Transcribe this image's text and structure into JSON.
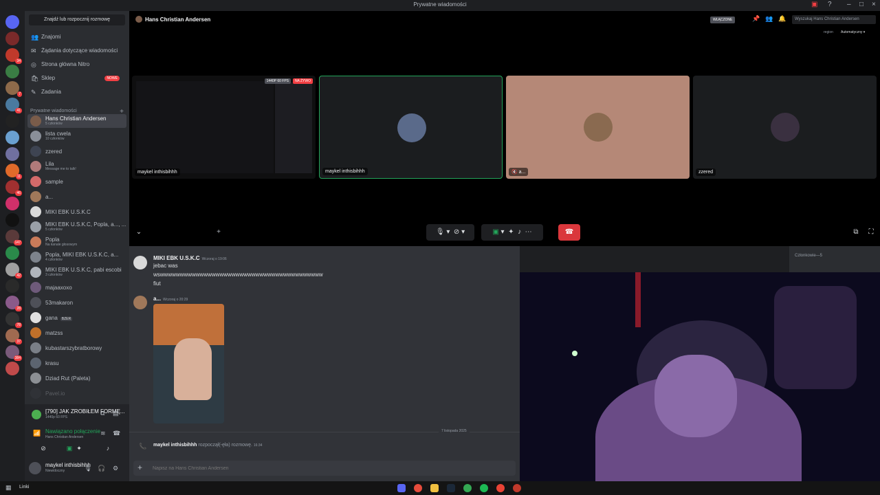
{
  "window": {
    "title": "Prywatne wiadomości"
  },
  "sidebar": {
    "find_button": "Znajdź lub rozpocznij rozmowę",
    "nav": [
      {
        "label": "Znajomi",
        "icon": "friends-icon"
      },
      {
        "label": "Żądania dotyczące wiadomości",
        "icon": "envelope-icon"
      },
      {
        "label": "Strona główna Nitro",
        "icon": "nitro-icon"
      },
      {
        "label": "Sklep",
        "icon": "shop-icon",
        "badge": "NOWE"
      },
      {
        "label": "Zadania",
        "icon": "quests-icon"
      }
    ],
    "section_title": "Prywatne wiadomości",
    "dms": [
      {
        "name": "Hans Christian Andersen",
        "sub": "5 członków",
        "color": "#7a5c4a",
        "active": true
      },
      {
        "name": "lista cwela",
        "sub": "10 członków",
        "color": "#8a8f99"
      },
      {
        "name": "zzered",
        "sub": "",
        "color": "#3e4452"
      },
      {
        "name": "Lila",
        "sub": "Message me to talk!",
        "color": "#b07a7a"
      },
      {
        "name": "sample",
        "sub": "",
        "color": "#d46a6a"
      },
      {
        "name": "a...",
        "sub": "",
        "color": "#a0785a"
      },
      {
        "name": "MIKI EBK U.S.K.C",
        "sub": "",
        "color": "#d9d9d9"
      },
      {
        "name": "MIKI EBK U.S.K.C, Popla, a..., ...",
        "sub": "5 członków",
        "color": "#9aa0a8"
      },
      {
        "name": "Popla",
        "sub": "Na kanale głosowym",
        "color": "#c97b5a"
      },
      {
        "name": "Popla, MIKI EBK U.S.K.C, a...",
        "sub": "4 członków",
        "color": "#7d838c"
      },
      {
        "name": "MIKI EBK U.S.K.C, pabi escobi",
        "sub": "3 członków",
        "color": "#b0b5bc"
      },
      {
        "name": "majaaxoxo",
        "sub": "",
        "color": "#6e5a7a"
      },
      {
        "name": "53makaron",
        "sub": "",
        "color": "#4e5058"
      },
      {
        "name": "gana",
        "sub": "",
        "tag": "BZER",
        "color": "#e0e0e0"
      },
      {
        "name": "matzss",
        "sub": "",
        "color": "#c0702a"
      },
      {
        "name": "kubastarszybratborowy",
        "sub": "",
        "color": "#7a7f87"
      },
      {
        "name": "krasu",
        "sub": "",
        "color": "#5c6470"
      },
      {
        "name": "Dziad Rut (Paleta)",
        "sub": "",
        "color": "#8c8f94"
      },
      {
        "name": "Pavel.io",
        "sub": "",
        "color": "#3a3d44"
      }
    ],
    "servers": [
      {
        "color": "#5865f2",
        "badge": ""
      },
      {
        "color": "#7a2a2a",
        "badge": ""
      },
      {
        "color": "#c0392b",
        "badge": "34"
      },
      {
        "color": "#3a7d44",
        "badge": ""
      },
      {
        "color": "#8e6a4a",
        "badge": "7"
      },
      {
        "color": "#4a7aa0",
        "badge": "41"
      },
      {
        "color": "#222",
        "badge": ""
      },
      {
        "color": "#6aa0d0",
        "badge": ""
      },
      {
        "color": "#7070a0",
        "badge": ""
      },
      {
        "color": "#e06a2a",
        "badge": "11"
      },
      {
        "color": "#a03030",
        "badge": "46"
      },
      {
        "color": "#d0306a",
        "badge": ""
      },
      {
        "color": "#111",
        "badge": ""
      },
      {
        "color": "#5a3a3a",
        "badge": "147"
      },
      {
        "color": "#2a8a4a",
        "badge": ""
      },
      {
        "color": "#a0a0a0",
        "badge": "42"
      },
      {
        "color": "#2a2a2a",
        "badge": ""
      },
      {
        "color": "#8a5a8a",
        "badge": "28"
      },
      {
        "color": "#333",
        "badge": "78"
      },
      {
        "color": "#a06a50",
        "badge": "37"
      },
      {
        "color": "#7a5a7a",
        "badge": "384"
      },
      {
        "color": "#c04a4a",
        "badge": ""
      }
    ],
    "new_badge": "NOWE"
  },
  "voice_panel": {
    "stream_title": "[790] JAK ZROBIŁEM FORMĘ...",
    "stream_sub": "1440p 60 FPS",
    "connection": "Nawiązano połączenie",
    "channel": "Hans Christian Andersen"
  },
  "user_panel": {
    "name": "maykel inthisbihhh",
    "status": "Niewidoczny"
  },
  "call": {
    "title": "Hans Christian Andersen",
    "on_badge": "WŁĄCZONE",
    "search_placeholder": "Wyszukaj Hans Christian Andersen",
    "region_label": "region",
    "region_value": "Automatyczny",
    "tiles": [
      {
        "label": "maykel inthisbihhh",
        "kind": "stream",
        "tag_quality": "1440P 60 FPS",
        "tag_live": "NA ŻYWO",
        "bg": "#111"
      },
      {
        "label": "maykel inthisbihhh",
        "kind": "avatar",
        "bg": "#1b1d1f",
        "avatar": "#5a6a8a",
        "border": "#23a55a"
      },
      {
        "label": "a...",
        "kind": "avatar",
        "bg": "#b58877",
        "avatar": "#8a6a50"
      },
      {
        "label": "zzered",
        "kind": "avatar",
        "bg": "#1b1d1f",
        "avatar": "#3a3040"
      }
    ]
  },
  "chat": {
    "messages": [
      {
        "author": "MIKI EBK U.S.K.C",
        "time": "Wczoraj o 19:06",
        "lines": [
          "jebac was",
          "wswwwwwwwwwwwwwwwwwwwwwwwwwwwwwwwwwwwwwwwww",
          "fiut"
        ]
      },
      {
        "author": "a...",
        "time": "Wczoraj o 20:29"
      }
    ],
    "date_separator": "7 listopada 2025",
    "system_author": "maykel inthisbihhh",
    "system_text": "rozpoczął(-ęła) rozmowę.",
    "system_time": "16:34",
    "input_placeholder": "Napisz na Hans Christian Andersen"
  },
  "members": {
    "header": "Członkowie—5"
  },
  "taskbar": {
    "label": "Linki"
  }
}
